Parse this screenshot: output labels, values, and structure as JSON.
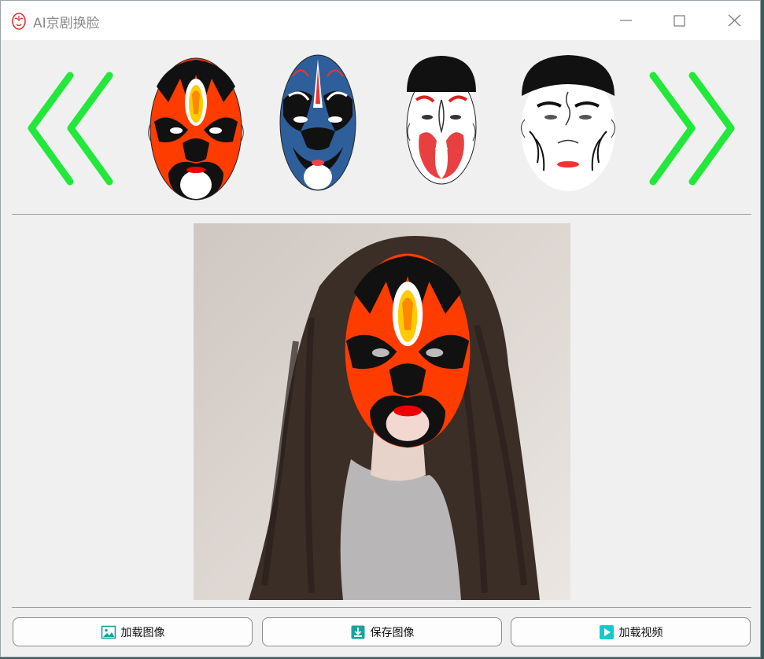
{
  "window": {
    "title": "AI京剧换脸"
  },
  "masks": [
    {
      "name": "red-black-mask",
      "main_color": "#ff3c00"
    },
    {
      "name": "blue-mask",
      "main_color": "#2f5f9a"
    },
    {
      "name": "white-red-mask",
      "main_color": "#e84040"
    },
    {
      "name": "white-elder-mask",
      "main_color": "#ffffff"
    }
  ],
  "arrows": {
    "color": "#22e83a"
  },
  "buttons": {
    "load_image": "加载图像",
    "save_image": "保存图像",
    "load_video": "加载视频"
  },
  "colors": {
    "accent_teal": "#15a3a0",
    "window_bg": "#f0f0f0"
  }
}
